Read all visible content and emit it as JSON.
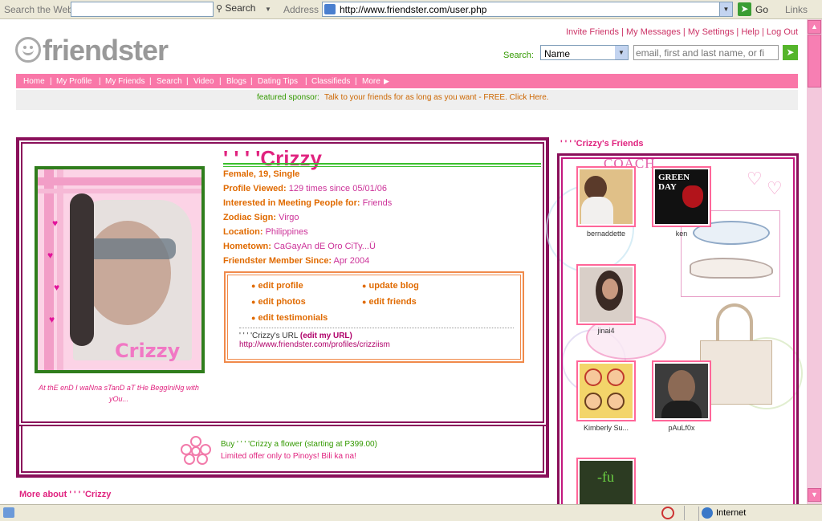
{
  "browser": {
    "search_label": "Search the Web",
    "search_button": "Search",
    "address_label": "Address",
    "url": "http://www.friendster.com/user.php",
    "go_label": "Go",
    "links_label": "Links",
    "status_zone": "Internet"
  },
  "header": {
    "logo": "friendster",
    "top_links": [
      "Invite Friends",
      "My Messages",
      "My Settings",
      "Help",
      "Log Out"
    ],
    "search_label": "Search:",
    "search_select": "Name",
    "search_placeholder": "email, first and last name, or fi"
  },
  "nav": {
    "items": [
      "Home",
      "My Profile",
      "My Friends",
      "Search",
      "Video",
      "Blogs",
      "Dating Tips",
      "Classifieds",
      "More"
    ]
  },
  "sponsor": {
    "label": "featured sponsor:",
    "text": "Talk to your friends for as long as you want - FREE. Click Here."
  },
  "profile": {
    "name": "' ' ' 'Crizzy",
    "photo_text": "Crizzy",
    "caption": "At thE enD I waNna sTanD aT tHe BeggIniNg with yOu...",
    "details": {
      "summary": "Female, 19, Single",
      "viewed_label": "Profile Viewed:",
      "viewed_value": "129 times since 05/01/06",
      "interested_label": "Interested in Meeting People for:",
      "interested_value": "Friends",
      "zodiac_label": "Zodiac Sign:",
      "zodiac_value": "Virgo",
      "location_label": "Location:",
      "location_value": "Philippines",
      "hometown_label": "Hometown:",
      "hometown_value": "CaGayAn dE Oro CiTy...Ü",
      "member_label": "Friendster Member Since:",
      "member_value": "Apr 2004"
    },
    "edit_links": {
      "edit_profile": "edit profile",
      "update_blog": "update blog",
      "edit_photos": "edit photos",
      "edit_friends": "edit friends",
      "edit_testimonials": "edit testimonials"
    },
    "url_label": "' ' ' 'Crizzy's URL",
    "edit_url": "(edit my URL)",
    "url_value": "http://www.friendster.com/profiles/crizziism"
  },
  "flower": {
    "line1": "Buy ' ' ' 'Crizzy a flower (starting at P399.00)",
    "line2": "Limited offer only to Pinoys! Bili ka na!"
  },
  "more_about": "More about ' ' ' 'Crizzy",
  "friends": {
    "title": "' ' ' 'Crizzy's Friends",
    "coach_text": "COACH",
    "list": [
      {
        "name": "bernaddette"
      },
      {
        "name": "ken"
      },
      {
        "name": "jinai4"
      },
      {
        "name": "Kimberly Su..."
      },
      {
        "name": "pAuLf0x"
      }
    ],
    "band_text": "GREEN DAY"
  },
  "colors": {
    "nav_pink": "#f977a8",
    "frame_purple": "#8a0f5a",
    "name_pink": "#e0237f",
    "label_orange": "#e06a00"
  }
}
